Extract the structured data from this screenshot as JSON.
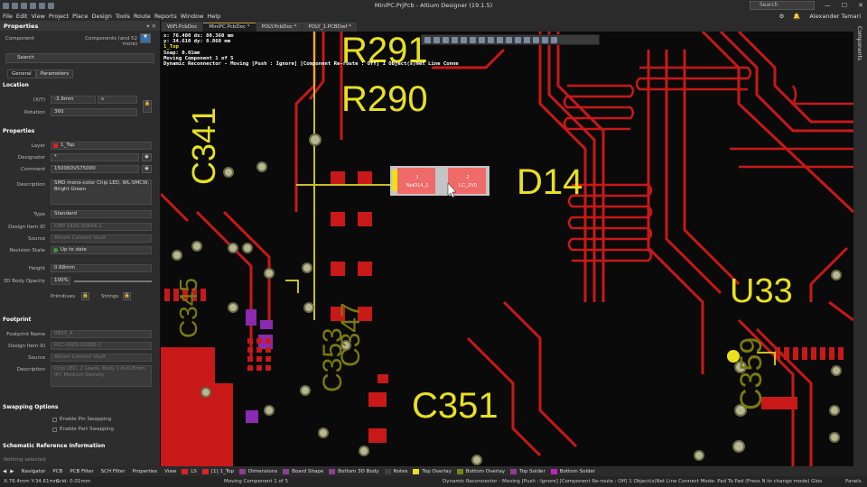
{
  "window": {
    "title": "MiniPC.PrjPcb - Altium Designer (19.1.5)",
    "search_placeholder": "Search",
    "user": "Alexander Tamari",
    "min": "—",
    "max": "☐",
    "close": "✕"
  },
  "menu": [
    "File",
    "Edit",
    "View",
    "Project",
    "Place",
    "Design",
    "Tools",
    "Route",
    "Reports",
    "Window",
    "Help"
  ],
  "doc_tabs": [
    {
      "label": "WiFi.PcbDoc",
      "active": false
    },
    {
      "label": "MiniPC.PcbDoc *",
      "active": true
    },
    {
      "label": "POLY.PcbDoc *",
      "active": false
    },
    {
      "label": "POLY_1.PCBDwf *",
      "active": false
    }
  ],
  "properties": {
    "panel_title": "Properties",
    "filter_label": "Component",
    "filter_value": "Components (and 52 more)",
    "search_placeholder": "Search",
    "tabs": [
      "General",
      "Parameters"
    ],
    "location": {
      "header": "Location",
      "xy_label": "(X/Y)",
      "x": "-3.9mm",
      "y": "s",
      "rotation_label": "Rotation",
      "rotation": "360"
    },
    "props": {
      "header": "Properties",
      "layer_label": "Layer",
      "layer": "1_Top",
      "designator_label": "Designator",
      "designator": "*",
      "comment_label": "Comment",
      "comment": "150060VS75000",
      "description_label": "Description",
      "description": "SMD mono-color Chip LED, WL-SMCW, Bright Green",
      "type_label": "Type",
      "type": "Standard",
      "design_item_label": "Design Item ID",
      "design_item": "CMP-1426-00694-1",
      "source_label": "Source",
      "source": "Altium Content Vault",
      "revision_label": "Revision State",
      "revision": "Up to date",
      "height_label": "Height",
      "height": "0.68mm",
      "opacity_label": "3D Body Opacity",
      "opacity": "100%",
      "primitives": "Primitives",
      "strings": "Strings"
    },
    "footprint": {
      "header": "Footprint",
      "name_label": "Footprint Name",
      "name": "0603_A",
      "item_label": "Design Item ID",
      "item": "PCC-0603-00260-1",
      "source_label": "Source",
      "source": "Altium Content Vault",
      "desc_label": "Description",
      "desc": "Chip LED, 2 Leads, Body 1.6x0.8mm, IPC Medium Density"
    },
    "swapping": {
      "header": "Swapping Options",
      "pin": "Enable Pin Swapping",
      "part": "Enable Part Swapping"
    },
    "schematic_header": "Schematic Reference Information",
    "bottom_text": "Nothing selected"
  },
  "info_overlay": {
    "line1": "x: 76.400   dx: 80.360 mm",
    "line2": "y: 34.610   dy:  0.860 mm",
    "layer": "1_Top",
    "snap": "Snap: 0.01mm",
    "moving": "Moving Component 1 of 5",
    "mode": "Dynamic Reconnector - Moving [Push : Ignore] [Component Re-route : Off] 1 Object(s)Net Line Conne"
  },
  "pcb_labels": {
    "r291": "R291",
    "r290": "R290",
    "c341": "C341",
    "d14": "D14",
    "u33": "U33",
    "c351": "C351",
    "c347": "C347",
    "c353": "C353",
    "c359": "C359",
    "c345": "C345",
    "pad1": "1",
    "pad2": "2",
    "net1": "NetD14_1",
    "net2": "LC_2V0"
  },
  "layers": [
    {
      "name": "LS",
      "color": "#e02020"
    },
    {
      "name": "[1] 1_Top",
      "color": "#e02020"
    },
    {
      "name": "Dimensions",
      "color": "#8a4090"
    },
    {
      "name": "Board Shape",
      "color": "#8a4090"
    },
    {
      "name": "Bottom 3D Body",
      "color": "#8a4090"
    },
    {
      "name": "Notes",
      "color": "#404040"
    },
    {
      "name": "Top Overlay",
      "color": "#e8e020"
    },
    {
      "name": "Bottom Overlay",
      "color": "#6a8a20"
    },
    {
      "name": "Top Solder",
      "color": "#8a4090"
    },
    {
      "name": "Bottom Solder",
      "color": "#c020c0"
    }
  ],
  "bottom_tabs": [
    "Navigator",
    "PCB",
    "PCB Filter",
    "SCH Filter",
    "Properties",
    "View"
  ],
  "status": {
    "coords": "X:76.4mm Y:34.61mm",
    "grid": "Grid: 0.01mm",
    "center": "Moving Component 1 of 5",
    "right": "Dynamic Reconnector - Moving [Push : Ignore] [Component Re-route : Off] 1 Object(s)Net Line Connect Mode: Pad To Pad (Press N to change mode) Gloss Strong",
    "panels": "Panels"
  },
  "right_panel": "Components"
}
